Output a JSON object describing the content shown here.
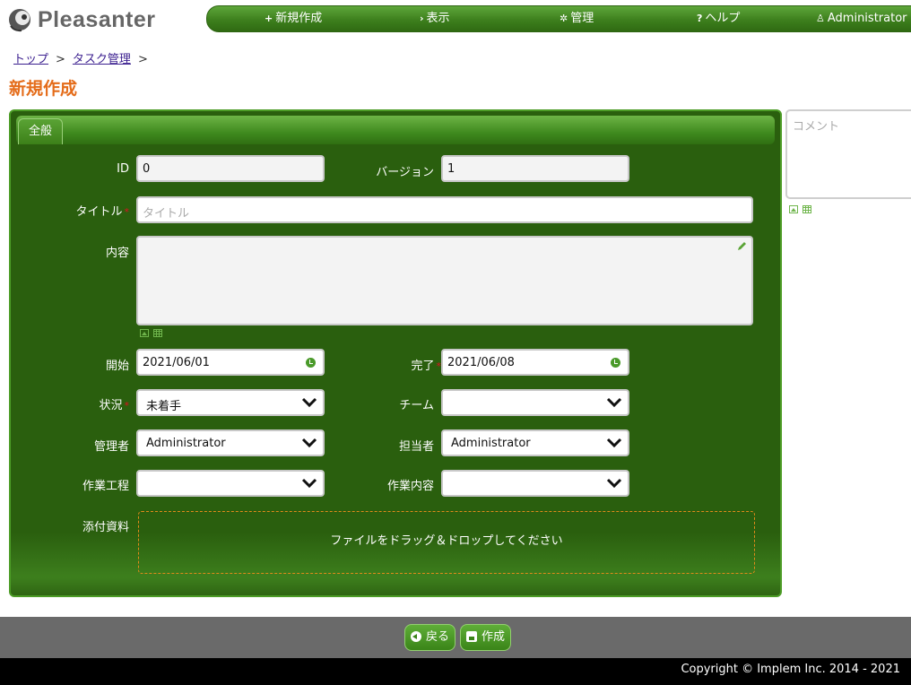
{
  "app": {
    "logo_text": "Pleasanter"
  },
  "nav": {
    "new": "新規作成",
    "view": "表示",
    "manage": "管理",
    "help": "ヘルプ",
    "user": "Administrator"
  },
  "breadcrumb": {
    "items": [
      "トップ",
      "タスク管理"
    ],
    "separator": ">"
  },
  "page_title": "新規作成",
  "tabs": [
    "全般"
  ],
  "form": {
    "id": {
      "label": "ID",
      "value": "0"
    },
    "version": {
      "label": "バージョン",
      "value": "1"
    },
    "title": {
      "label": "タイトル",
      "placeholder": "タイトル",
      "value": ""
    },
    "body": {
      "label": "内容",
      "value": ""
    },
    "start": {
      "label": "開始",
      "value": "2021/06/01"
    },
    "complete": {
      "label": "完了",
      "value": "2021/06/08"
    },
    "status": {
      "label": "状況",
      "value": "未着手"
    },
    "team": {
      "label": "チーム",
      "value": ""
    },
    "manager": {
      "label": "管理者",
      "value": "Administrator"
    },
    "owner": {
      "label": "担当者",
      "value": "Administrator"
    },
    "process": {
      "label": "作業工程",
      "value": ""
    },
    "work": {
      "label": "作業内容",
      "value": ""
    },
    "attachments": {
      "label": "添付資料",
      "dropzone_text": "ファイルをドラッグ＆ドロップしてください"
    },
    "required_mark": "*"
  },
  "comment": {
    "placeholder": "コメント"
  },
  "buttons": {
    "back": "戻る",
    "create": "作成"
  },
  "footer": {
    "copyright": "Copyright © Implem Inc. 2014 - 2021"
  },
  "colors": {
    "accent": "#3d7f1d",
    "title": "#e46c1a",
    "panel": "#2a5f0e"
  }
}
